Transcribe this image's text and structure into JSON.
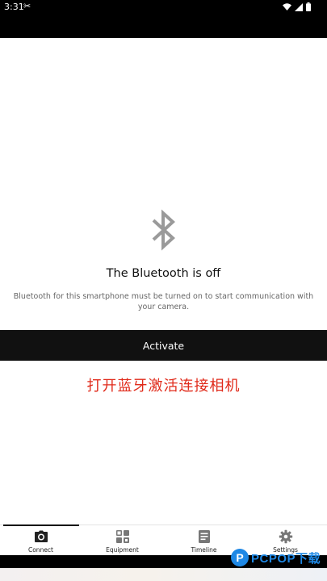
{
  "status_bar": {
    "time": "3:31",
    "extra_glyph": "✂"
  },
  "main": {
    "icon": "bluetooth-icon",
    "title": "The Bluetooth is off",
    "description": "Bluetooth for this smartphone must be turned on to start communication with your camera.",
    "activate_label": "Activate",
    "annotation": "打开蓝牙激活连接相机"
  },
  "tabs": [
    {
      "label": "Connect",
      "icon": "camera-icon",
      "active": true
    },
    {
      "label": "Equipment",
      "icon": "equipment-icon",
      "active": false
    },
    {
      "label": "Timeline",
      "icon": "timeline-icon",
      "active": false
    },
    {
      "label": "Settings",
      "icon": "gear-icon",
      "active": false
    }
  ],
  "watermark": {
    "logo_letter": "P",
    "text": "PCPOP下载"
  },
  "colors": {
    "bar_black": "#000000",
    "annotation_red": "#e02a1a",
    "bluetooth_gray": "#9a9a9a",
    "watermark_blue": "#1e88e5"
  }
}
